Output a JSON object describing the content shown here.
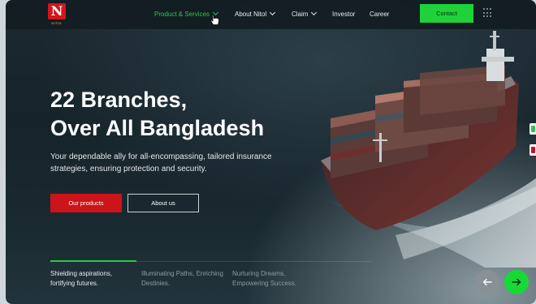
{
  "brand": {
    "logo_letter": "N",
    "logo_caption": "NITOL"
  },
  "nav": {
    "items": [
      {
        "label": "Product & Services",
        "has_dropdown": true,
        "active": true
      },
      {
        "label": "About Nitol",
        "has_dropdown": true,
        "active": false
      },
      {
        "label": "Claim",
        "has_dropdown": true,
        "active": false
      },
      {
        "label": "Investor",
        "has_dropdown": false,
        "active": false
      },
      {
        "label": "Career",
        "has_dropdown": false,
        "active": false
      }
    ],
    "contact_label": "Contact"
  },
  "hero": {
    "title_line1": "22 Branches,",
    "title_line2": "Over All Bangladesh",
    "subtitle": "Your dependable ally for all-encompassing, tailored insurance strategies, ensuring protection and security.",
    "primary_button": "Our products",
    "secondary_button": "About us"
  },
  "slider": {
    "tabs": [
      {
        "line1": "Shielding aspirations,",
        "line2": "fortifying futures.",
        "active": true
      },
      {
        "line1": "Illuminating Paths, Enriching",
        "line2": "Destinies.",
        "active": false
      },
      {
        "line1": "Nurturing Dreams,",
        "line2": "Empowering Success.",
        "active": false
      }
    ],
    "prev_icon": "arrow-left-icon",
    "next_icon": "arrow-right-icon"
  },
  "colors": {
    "accent_green": "#1fd23a",
    "brand_red": "#cc1419",
    "background_dark": "#16232a"
  }
}
